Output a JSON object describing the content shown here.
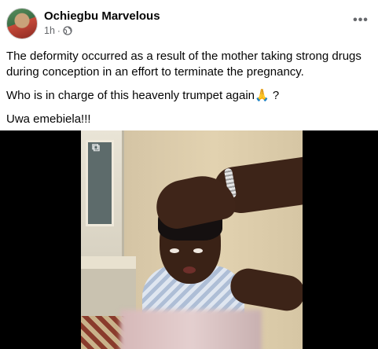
{
  "post": {
    "author": "Ochiegbu Marvelous",
    "time": "1h",
    "separator": "·",
    "privacy_icon": "globe-icon",
    "more_icon": "more-options-icon",
    "more_label": "•••",
    "paragraphs": [
      "The deformity occurred as a result of the mother taking strong drugs during conception in an effort to terminate the pregnancy.",
      "Who is in charge of this heavenly trumpet again🙏 ?",
      "Uwa emebiela!!!"
    ]
  },
  "media": {
    "type": "video",
    "description_icon": "video-thumbnail"
  }
}
